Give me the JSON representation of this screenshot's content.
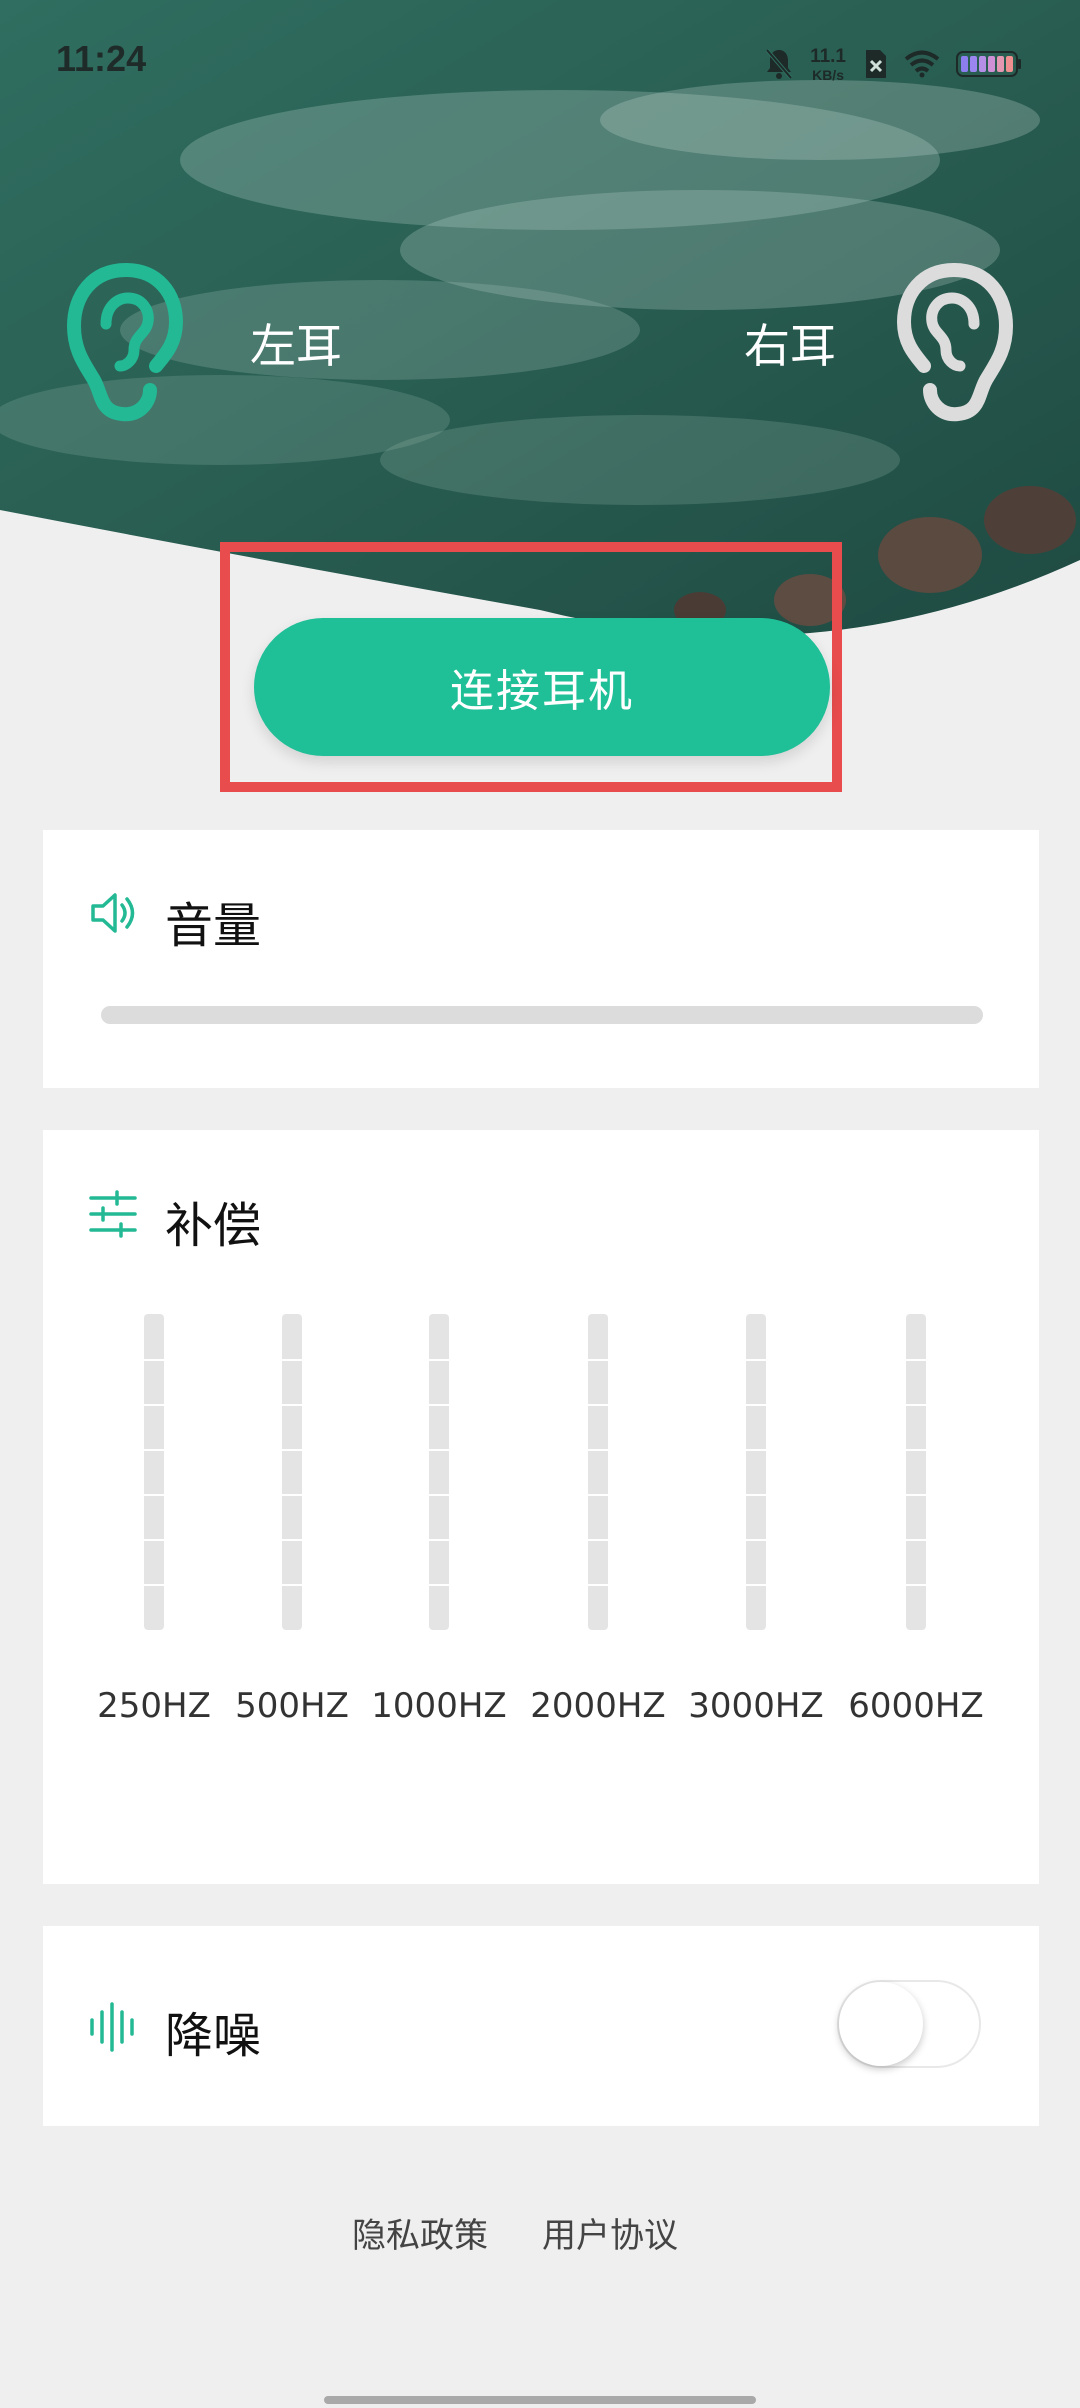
{
  "status_bar": {
    "time": "11:24",
    "net_speed_value": "11.1",
    "net_speed_unit": "KB/s",
    "icons": [
      "bell-muted-icon",
      "sim-off-icon",
      "wifi-icon",
      "battery-icon"
    ]
  },
  "header": {
    "left_ear_label": "左耳",
    "right_ear_label": "右耳",
    "left_ear_icon": "ear-icon",
    "right_ear_icon": "ear-icon",
    "connect_button_label": "连接耳机"
  },
  "volume": {
    "title": "音量",
    "icon": "speaker-icon",
    "level": 0
  },
  "compensation": {
    "title": "补偿",
    "icon": "sliders-icon",
    "bands": [
      {
        "label": "250HZ",
        "value": 0
      },
      {
        "label": "500HZ",
        "value": 0
      },
      {
        "label": "1000HZ",
        "value": 0
      },
      {
        "label": "2000HZ",
        "value": 0
      },
      {
        "label": "3000HZ",
        "value": 0
      },
      {
        "label": "6000HZ",
        "value": 0
      }
    ]
  },
  "noise_reduction": {
    "title": "降噪",
    "icon": "waveform-icon",
    "enabled": false
  },
  "footer": {
    "privacy_label": "隐私政策",
    "terms_label": "用户协议"
  },
  "colors": {
    "accent": "#1fbf97",
    "highlight": "#e84c4c",
    "background": "#efefef"
  }
}
